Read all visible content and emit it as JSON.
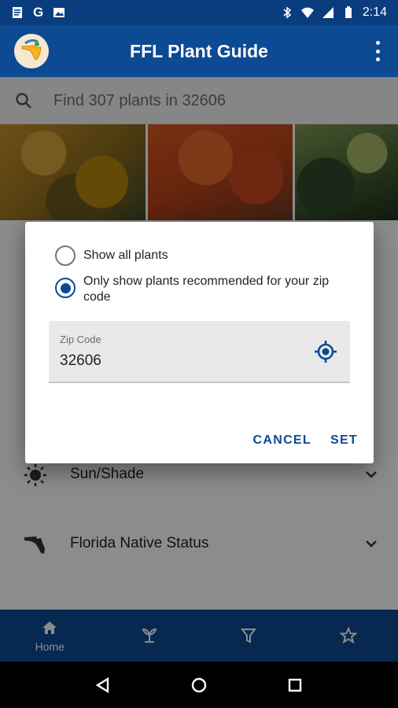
{
  "status_bar": {
    "time": "2:14",
    "left_icons": [
      "document-icon",
      "google-icon",
      "image-icon"
    ],
    "right_icons": [
      "bluetooth-icon",
      "wifi-icon",
      "cellular-icon",
      "battery-icon"
    ]
  },
  "app_bar": {
    "title": "FFL Plant Guide",
    "logo_icon": "florida-logo-icon",
    "menu_icon": "more-vert-icon"
  },
  "search": {
    "placeholder": "Find 307 plants in 32606"
  },
  "filters": [
    {
      "label": "Sun/Shade",
      "icon": "sun-icon"
    },
    {
      "label": "Florida Native Status",
      "icon": "florida-map-icon"
    }
  ],
  "dialog": {
    "options": [
      {
        "label": "Show all plants",
        "selected": false
      },
      {
        "label": "Only show plants recommended for your zip code",
        "selected": true
      }
    ],
    "zip_label": "Zip Code",
    "zip_value": "32606",
    "cancel_label": "CANCEL",
    "set_label": "SET"
  },
  "bottom_nav": {
    "items": [
      {
        "label": "Home",
        "icon": "home-icon"
      },
      {
        "label": "",
        "icon": "plant-icon"
      },
      {
        "label": "",
        "icon": "filter-icon"
      },
      {
        "label": "",
        "icon": "star-icon"
      }
    ]
  },
  "colors": {
    "primary": "#0d4a94",
    "status_bar": "#0a3d7e",
    "scrim": "rgba(0,0,0,0.45)"
  }
}
